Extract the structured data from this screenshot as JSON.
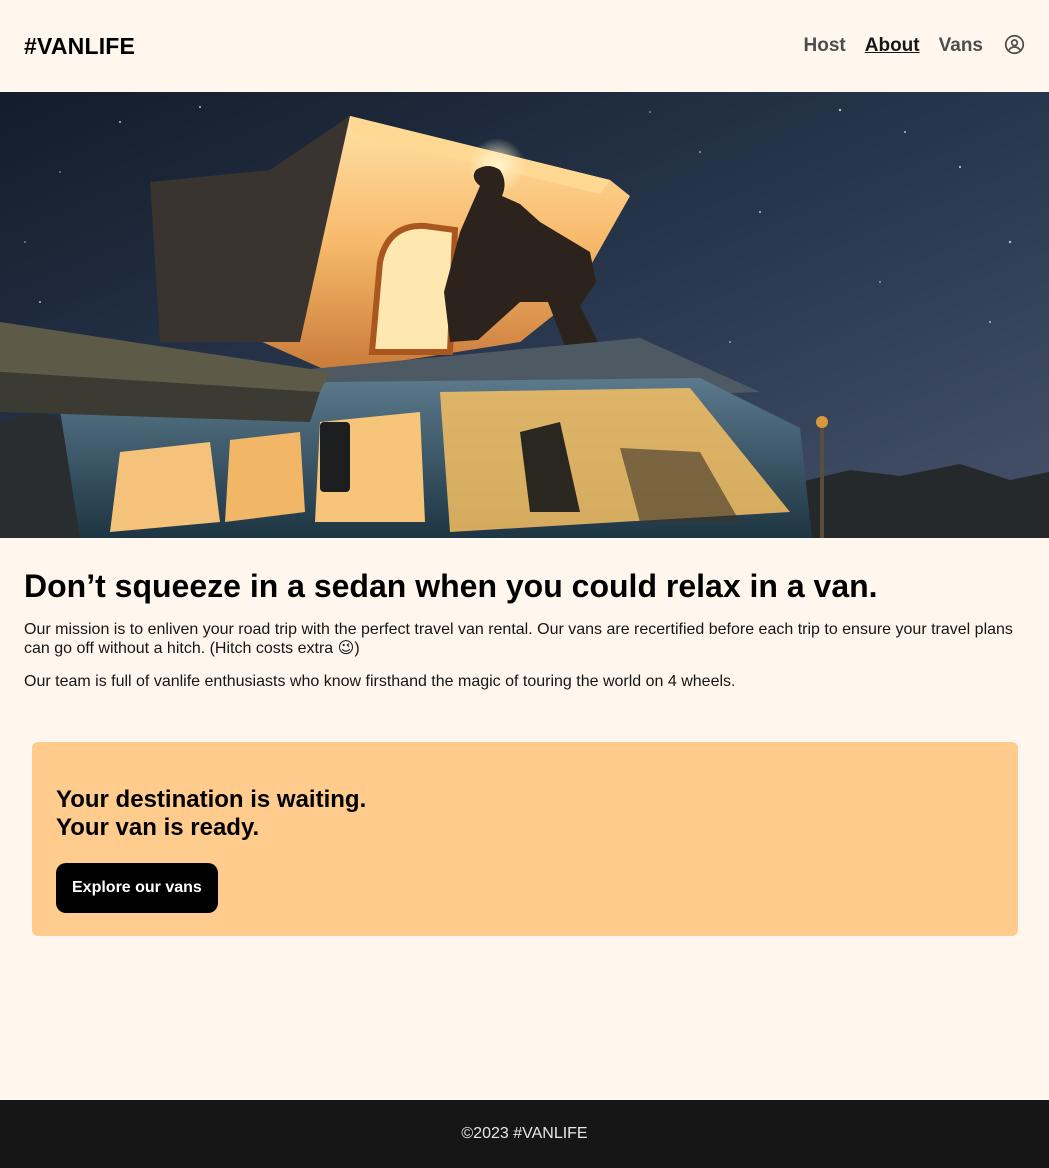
{
  "header": {
    "logo": "#VANLIFE",
    "nav": [
      {
        "label": "Host",
        "active": false
      },
      {
        "label": "About",
        "active": true
      },
      {
        "label": "Vans",
        "active": false
      }
    ],
    "user_icon": "user-circle-icon"
  },
  "hero": {
    "image": "night-camper-van-photo"
  },
  "main": {
    "title": "Don’t squeeze in a sedan when you could relax in a van.",
    "paragraph1": "Our mission is to enliven your road trip with the perfect travel van rental. Our vans are recertified before each trip to ensure your travel plans can go off without a hitch. (Hitch costs extra 😉)",
    "paragraph2": "Our team is full of vanlife enthusiasts who know firsthand the magic of touring the world on 4 wheels."
  },
  "cta": {
    "line1": "Your destination is waiting.",
    "line2": "Your van is ready.",
    "button_label": "Explore our vans"
  },
  "footer": {
    "text": "©2023 #VANLIFE"
  },
  "colors": {
    "background": "#FFF7ED",
    "cta_background": "#FFCC8D",
    "footer_background": "#161616",
    "button_background": "#000000"
  }
}
